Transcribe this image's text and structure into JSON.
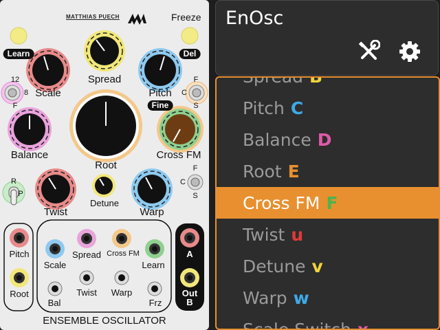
{
  "module": {
    "maker": "MATTHIAS PUECH",
    "freeze_label": "Freeze",
    "name": "ENSEMBLE OSCILLATOR",
    "labels": {
      "learn": "Learn",
      "del": "Del",
      "scale": "Scale",
      "spread": "Spread",
      "pitch": "Pitch",
      "fine": "Fine",
      "balance": "Balance",
      "root": "Root",
      "cross_fm": "Cross FM",
      "twist": "Twist",
      "detune": "Detune",
      "warp": "Warp",
      "switch_12": "12",
      "switch_8": "8",
      "switch_f_left": "F",
      "switch_f_top": "F",
      "switch_c": "C",
      "switch_s": "S",
      "switch2_f": "F",
      "switch2_c": "C",
      "switch2_s": "S",
      "switch3_r": "R",
      "switch3_p": "P",
      "jack_pitch": "Pitch",
      "jack_root": "Root",
      "jack_scale": "Scale",
      "jack_spread": "Spread",
      "jack_cross_fm": "Cross FM",
      "jack_learn": "Learn",
      "jack_bal": "Bal",
      "jack_twist": "Twist",
      "jack_warp": "Warp",
      "jack_frz": "Frz",
      "out_a": "A",
      "out_b": "Out\nB"
    }
  },
  "inspector": {
    "title": "EnOsc",
    "tools_icon": "wrench-screwdriver-icon",
    "settings_icon": "gear-icon",
    "accent": "#e8902f",
    "params": [
      {
        "name": "Spread",
        "key": "B",
        "key_color": "#f0d43a"
      },
      {
        "name": "Pitch",
        "key": "C",
        "key_color": "#3fa9e6"
      },
      {
        "name": "Balance",
        "key": "D",
        "key_color": "#e05aa8"
      },
      {
        "name": "Root",
        "key": "E",
        "key_color": "#e8902f"
      },
      {
        "name": "Cross FM",
        "key": "F",
        "key_color": "#4db34d",
        "selected": true
      },
      {
        "name": "Twist",
        "key": "u",
        "key_color": "#e03a3a"
      },
      {
        "name": "Detune",
        "key": "v",
        "key_color": "#f0d43a"
      },
      {
        "name": "Warp",
        "key": "w",
        "key_color": "#3fa9e6"
      },
      {
        "name": "Scale Switch",
        "key": "x",
        "key_color": "#e05aa8"
      }
    ]
  }
}
